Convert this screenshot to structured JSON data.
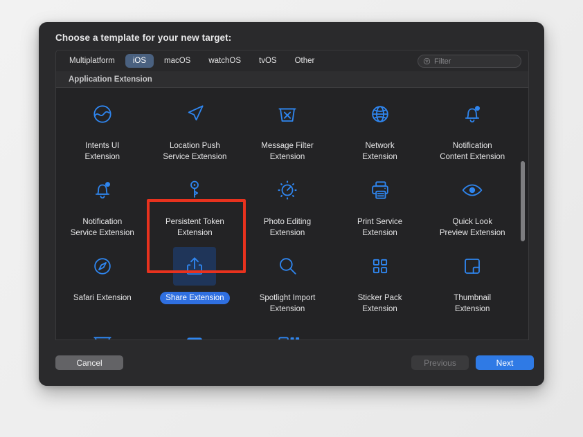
{
  "dialog": {
    "title": "Choose a template for your new target:"
  },
  "tabs": [
    {
      "label": "Multiplatform",
      "selected": false
    },
    {
      "label": "iOS",
      "selected": true
    },
    {
      "label": "macOS",
      "selected": false
    },
    {
      "label": "watchOS",
      "selected": false
    },
    {
      "label": "tvOS",
      "selected": false
    },
    {
      "label": "Other",
      "selected": false
    }
  ],
  "filter": {
    "placeholder": "Filter",
    "value": "",
    "icon": "filter-icon"
  },
  "section": {
    "header": "Application Extension"
  },
  "templates": [
    {
      "label": "Intents UI\nExtension",
      "icon": "intents-ui-icon",
      "selected": false
    },
    {
      "label": "Location Push\nService Extension",
      "icon": "location-push-icon",
      "selected": false
    },
    {
      "label": "Message Filter\nExtension",
      "icon": "message-filter-icon",
      "selected": false
    },
    {
      "label": "Network\nExtension",
      "icon": "network-globe-icon",
      "selected": false
    },
    {
      "label": "Notification\nContent Extension",
      "icon": "notification-bell-icon",
      "selected": false
    },
    {
      "label": "Notification\nService Extension",
      "icon": "notification-bell-icon",
      "selected": false
    },
    {
      "label": "Persistent Token\nExtension",
      "icon": "key-icon",
      "selected": false
    },
    {
      "label": "Photo Editing\nExtension",
      "icon": "brightness-dial-icon",
      "selected": false
    },
    {
      "label": "Print Service\nExtension",
      "icon": "printer-icon",
      "selected": false
    },
    {
      "label": "Quick Look\nPreview Extension",
      "icon": "eye-icon",
      "selected": false
    },
    {
      "label": "Safari Extension",
      "icon": "compass-icon",
      "selected": false
    },
    {
      "label": "Share Extension",
      "icon": "share-upload-icon",
      "selected": true
    },
    {
      "label": "Spotlight Import\nExtension",
      "icon": "magnifier-icon",
      "selected": false
    },
    {
      "label": "Sticker Pack\nExtension",
      "icon": "grid-squares-icon",
      "selected": false
    },
    {
      "label": "Thumbnail\nExtension",
      "icon": "thumbnail-corner-icon",
      "selected": false
    },
    {
      "label": "",
      "icon": "inbox-tray-icon",
      "selected": false
    },
    {
      "label": "",
      "icon": "keyboard-icon",
      "selected": false
    },
    {
      "label": "",
      "icon": "square-dots-icon",
      "selected": false
    },
    {
      "label": "",
      "icon": "",
      "selected": false
    },
    {
      "label": "",
      "icon": "",
      "selected": false
    }
  ],
  "footer": {
    "cancel_label": "Cancel",
    "previous_label": "Previous",
    "next_label": "Next"
  },
  "colors": {
    "accent_blue": "#2f7ae5",
    "icon_blue": "#2f86f0",
    "selected_tab": "#4a6180",
    "annotation_red": "#e8321e",
    "dialog_bg": "#2a2a2c",
    "grid_bg": "#232325"
  }
}
